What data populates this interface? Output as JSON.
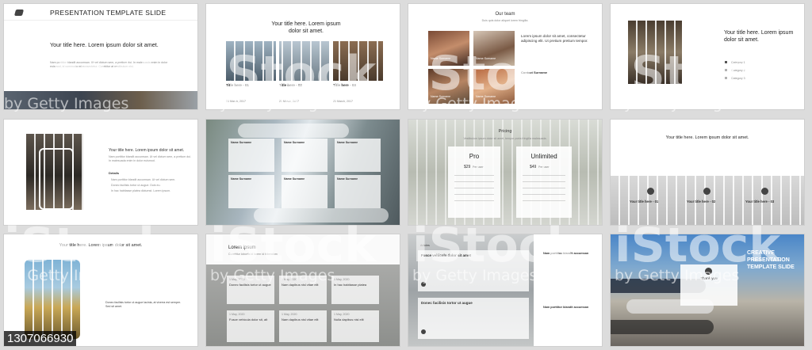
{
  "slide1": {
    "header": "PRESENTATION TEMPLATE SLIDE",
    "title": "Your title here. Lorem ipsum dolor sit amet.",
    "body": "Nam porttitor blandit accumsan. Ut vel dictum sem, a pretium dui. In malesuada enim in dolor euismod, id commodo mi consectetur. Curabitur at vestibulum nisi."
  },
  "slide2": {
    "title": "Your title here. Lorem ipsum dolor sit amet.",
    "items": [
      {
        "label": "Title here - 01",
        "date": "21 March, 2017"
      },
      {
        "label": "Title here - 02",
        "date": "21 March, 2017"
      },
      {
        "label": "Title here - 03",
        "date": "21 March, 2017"
      }
    ]
  },
  "slide3": {
    "title": "Our team",
    "subtitle": "Duis quis dolor aliquet lorem fringilla.",
    "heading": "Lorem ipsum dolor sit amet, consectetur adipiscing elit. Ut pretium pretium tempor.",
    "members": [
      "Name Surname",
      "Name Surname",
      "Name Surname",
      "Name Surname"
    ],
    "contact": "Contact Surname"
  },
  "slide4": {
    "title": "Your title here. Lorem ipsum dolor sit amet.",
    "list": [
      "Category 1",
      "Category 2",
      "Category 3"
    ]
  },
  "slide5": {
    "title": "Your title here. Lorem ipsum dolor sit amet.",
    "body": "Nam porttitor blandit accumsan. Ut vel dictum sem, a pretium dui. In malesuada enim in dolor euismod.",
    "details_label": "Details",
    "bullets": [
      "Nam porttitor blandit accumsan. Ut vel dictum sem.",
      "Donec facilisis tortor ut augue. Duis eu.",
      "In hac habitasse platea dictumst. Lorem ipsum."
    ]
  },
  "slide6": {
    "cards": [
      "Name Surname",
      "Name Surname",
      "Name Surname",
      "Name Surname",
      "Name Surname",
      "Name Surname"
    ]
  },
  "slide7": {
    "title": "Pricing",
    "subtitle": "Vestibulum ipsum dolor sit amet, tempor porta fringilla malesuada.",
    "plans": [
      {
        "name": "Pro",
        "price": "$29",
        "period": "Per user"
      },
      {
        "name": "Unlimited",
        "price": "$49",
        "period": "Per user"
      }
    ]
  },
  "slide8": {
    "title": "Your title here. Lorem ipsum dolor sit amet.",
    "items": [
      "Your title here - 01",
      "Your title here - 02",
      "Your title here - 03"
    ]
  },
  "slide9": {
    "title": "Your title here. Lorem ipsum dolor sit amet.",
    "body": "Donec facilisis tortor ut augue lacinia, at viverra est semper. Sed sit amet.",
    "stock_id": "1307066930"
  },
  "slide10": {
    "title": "Lorem ipsum",
    "subtitle": "Curabitur lobortis id lorem id bibendum",
    "posts": [
      {
        "date": "1 May, 2020",
        "title": "Donec facilisis tortor ut augue"
      },
      {
        "date": "1 May, 2020",
        "title": "Nam dapibus nisl vitae elit"
      },
      {
        "date": "1 May, 2020",
        "title": "In hac habitasse platea"
      },
      {
        "date": "1 May, 2020",
        "title": "Fusce vehicula dolor sit, alt"
      },
      {
        "date": "1 May, 2020",
        "title": "Nam dapibus nisl vitae elit"
      },
      {
        "date": "1 May, 2020",
        "title": "Nulla dapibus nisl elit"
      }
    ]
  },
  "slide11": {
    "label": "Articles",
    "heading1": "Fusce vehicula dolor sit amet",
    "heading2": "Donec facilisis tortor ut augue",
    "side1": "Nam porttitor blandit accumsan",
    "side2": "Nam porttitor blandit accumsan"
  },
  "slide12": {
    "title": "CREATIVE PRESENTATION TEMPLATE SLIDE",
    "thanks": "Thank you"
  },
  "watermark": {
    "brand": "iStock",
    "sub": "by Getty Images"
  }
}
